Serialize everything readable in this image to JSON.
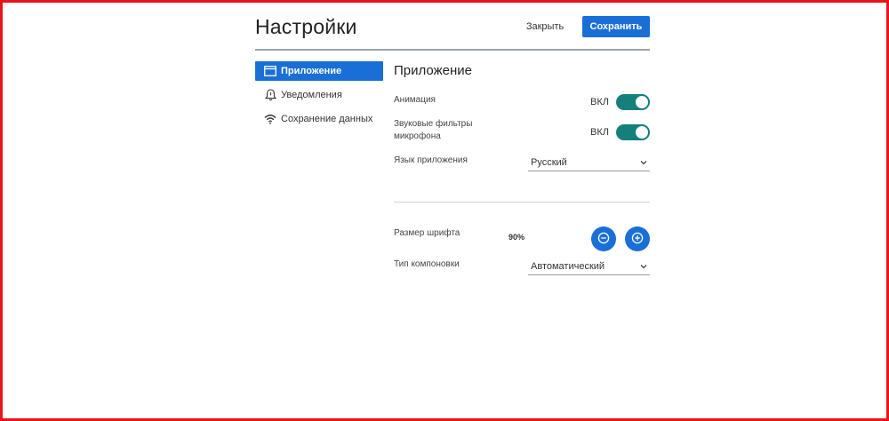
{
  "header": {
    "title": "Настройки",
    "close_label": "Закрыть",
    "save_label": "Сохранить"
  },
  "sidebar": {
    "items": [
      {
        "label": "Приложение",
        "icon": "window-icon",
        "active": true
      },
      {
        "label": "Уведомления",
        "icon": "bell-icon",
        "active": false
      },
      {
        "label": "Сохранение данных",
        "icon": "wifi-icon",
        "active": false
      }
    ]
  },
  "main": {
    "section_title": "Приложение",
    "animation": {
      "label": "Анимация",
      "state_text": "ВКЛ",
      "on": true
    },
    "mic_filters": {
      "label_line1": "Звуковые фильтры",
      "label_line2": "микрофона",
      "state_text": "ВКЛ",
      "on": true
    },
    "language": {
      "label": "Язык приложения",
      "value": "Русский"
    },
    "font_size": {
      "label": "Размер шрифта",
      "value": "90%"
    },
    "layout_type": {
      "label": "Тип компоновки",
      "value": "Автоматический"
    }
  },
  "colors": {
    "accent": "#1a6fd6",
    "toggle_on": "#157f7a",
    "frame_border": "#e8141a"
  }
}
